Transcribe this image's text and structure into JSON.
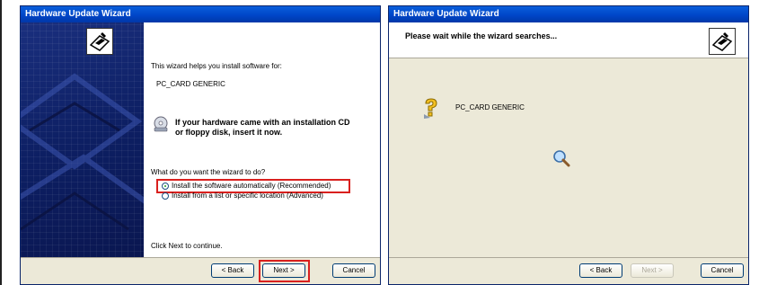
{
  "left_wizard": {
    "title": "Hardware Update Wizard",
    "intro": "This wizard helps you install software for:",
    "device": "PC_CARD GENERIC",
    "cd_hint_line1": "If your hardware came with an installation CD",
    "cd_hint_line2": "or floppy disk, insert it now.",
    "question": "What do you want the wizard to do?",
    "options": [
      {
        "label": "Install the software automatically (Recommended)",
        "selected": true
      },
      {
        "label": "Install from a list or specific location (Advanced)",
        "selected": false
      }
    ],
    "footer_text": "Click Next to continue.",
    "buttons": {
      "back": "< Back",
      "next": "Next >",
      "cancel": "Cancel"
    }
  },
  "right_wizard": {
    "title": "Hardware Update Wizard",
    "header": "Please wait while the wizard searches...",
    "device": "PC_CARD GENERIC",
    "buttons": {
      "back": "< Back",
      "next": "Next >",
      "cancel": "Cancel"
    },
    "next_disabled": true
  },
  "colors": {
    "titlebar": "#0046c8",
    "highlight": "#d9201e",
    "dialog_bg": "#ece9d8"
  }
}
